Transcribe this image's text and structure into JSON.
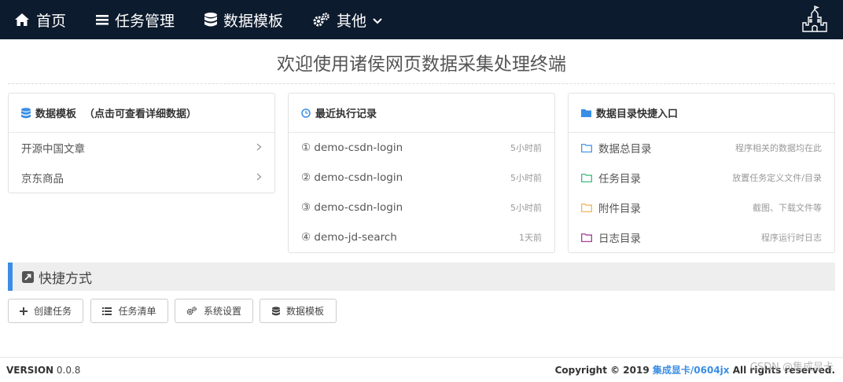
{
  "nav": {
    "home": "首页",
    "tasks": "任务管理",
    "templates": "数据模板",
    "other": "其他"
  },
  "header": {
    "title": "欢迎使用诸侯网页数据采集处理终端"
  },
  "templates_panel": {
    "title": "数据模板",
    "subtitle": "（点击可查看详细数据）",
    "items": [
      {
        "label": "开源中国文章"
      },
      {
        "label": "京东商品"
      }
    ]
  },
  "recent_panel": {
    "title": "最近执行记录",
    "items": [
      {
        "label": "① demo-csdn-login",
        "time": "5小时前"
      },
      {
        "label": "② demo-csdn-login",
        "time": "5小时前"
      },
      {
        "label": "③ demo-csdn-login",
        "time": "5小时前"
      },
      {
        "label": "④ demo-jd-search",
        "time": "1天前"
      }
    ]
  },
  "dirs_panel": {
    "title": "数据目录快捷入口",
    "items": [
      {
        "label": "数据总目录",
        "desc": "程序相关的数据均在此",
        "color": "#3a8ee6"
      },
      {
        "label": "任务目录",
        "desc": "放置任务定义文件/目录",
        "color": "#2bb673"
      },
      {
        "label": "附件目录",
        "desc": "截图、下载文件等",
        "color": "#f0ad4e"
      },
      {
        "label": "日志目录",
        "desc": "程序运行时日志",
        "color": "#9b2d8e"
      }
    ]
  },
  "shortcuts": {
    "title": "快捷方式",
    "buttons": [
      {
        "label": "创建任务"
      },
      {
        "label": "任务清单"
      },
      {
        "label": "系统设置"
      },
      {
        "label": "数据模板"
      }
    ]
  },
  "footer": {
    "version_label": "VERSION",
    "version": "0.0.8",
    "copyright_prefix": "Copyright © 2019",
    "copyright_link": "集成显卡/0604jx",
    "copyright_suffix": "All rights reserved.",
    "watermark": "CSDN @集成显卡"
  },
  "colors": {
    "nav_bg": "#0d1b2e",
    "accent": "#3a8ee6"
  }
}
